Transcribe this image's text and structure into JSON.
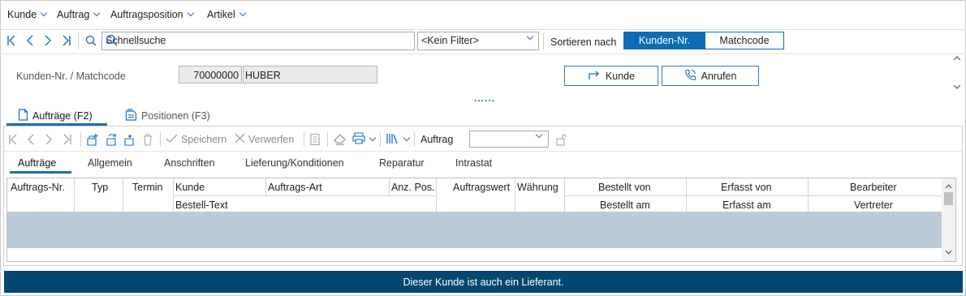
{
  "menu": {
    "items": [
      {
        "label": "Kunde"
      },
      {
        "label": "Auftrag"
      },
      {
        "label": "Auftragsposition"
      },
      {
        "label": "Artikel"
      }
    ]
  },
  "nav": {
    "search_value": "Schnellsuche",
    "filter_value": "<Kein Filter>",
    "sort_label": "Sortieren nach",
    "sort_options": [
      {
        "label": "Kunden-Nr.",
        "active": true
      },
      {
        "label": "Matchcode",
        "active": false
      }
    ]
  },
  "header": {
    "field_label": "Kunden-Nr. / Matchcode",
    "kunden_nr": "70000000",
    "matchcode": "HUBER",
    "kunde_button": "Kunde",
    "anrufen_button": "Anrufen",
    "splitter": "......"
  },
  "main_tabs": [
    {
      "label": "Aufträge (F2)",
      "active": true
    },
    {
      "label": "Positionen (F3)",
      "active": false
    }
  ],
  "toolbar": {
    "save_label": "Speichern",
    "discard_label": "Verwerfen",
    "auftrag_label": "Auftrag",
    "auftrag_value": ""
  },
  "sub_tabs": [
    {
      "label": "Aufträge",
      "active": true
    },
    {
      "label": "Allgemein",
      "active": false
    },
    {
      "label": "Anschriften",
      "active": false
    },
    {
      "label": "Lieferung/Konditionen",
      "active": false
    },
    {
      "label": "Reparatur",
      "active": false
    },
    {
      "label": "Intrastat",
      "active": false
    }
  ],
  "grid": {
    "headers": {
      "auftrags_nr": "Auftrags-Nr.",
      "typ": "Typ",
      "termin": "Termin",
      "kunde": "Kunde",
      "auftrags_art": "Auftrags-Art",
      "anz_pos": "Anz. Pos.",
      "auftragswert": "Auftragswert",
      "waehrung": "Währung",
      "bestellt_von": "Bestellt von",
      "erfasst_von": "Erfasst von",
      "bearbeiter": "Bearbeiter",
      "bestell_text": "Bestell-Text",
      "bestellt_am": "Bestellt am",
      "erfasst_am": "Erfasst am",
      "vertreter": "Vertreter"
    }
  },
  "status": {
    "message": "Dieser Kunde ist auch ein Lieferant."
  },
  "colors": {
    "accent": "#0e6cb4",
    "status_bar": "#02476f",
    "selected_row": "#bccbd9"
  },
  "icons": [
    "first-icon",
    "prev-icon",
    "next-icon",
    "last-icon",
    "search-icon",
    "arrow-redirect-icon",
    "phone-icon",
    "document-icon",
    "printer-icon",
    "lock-icon"
  ]
}
